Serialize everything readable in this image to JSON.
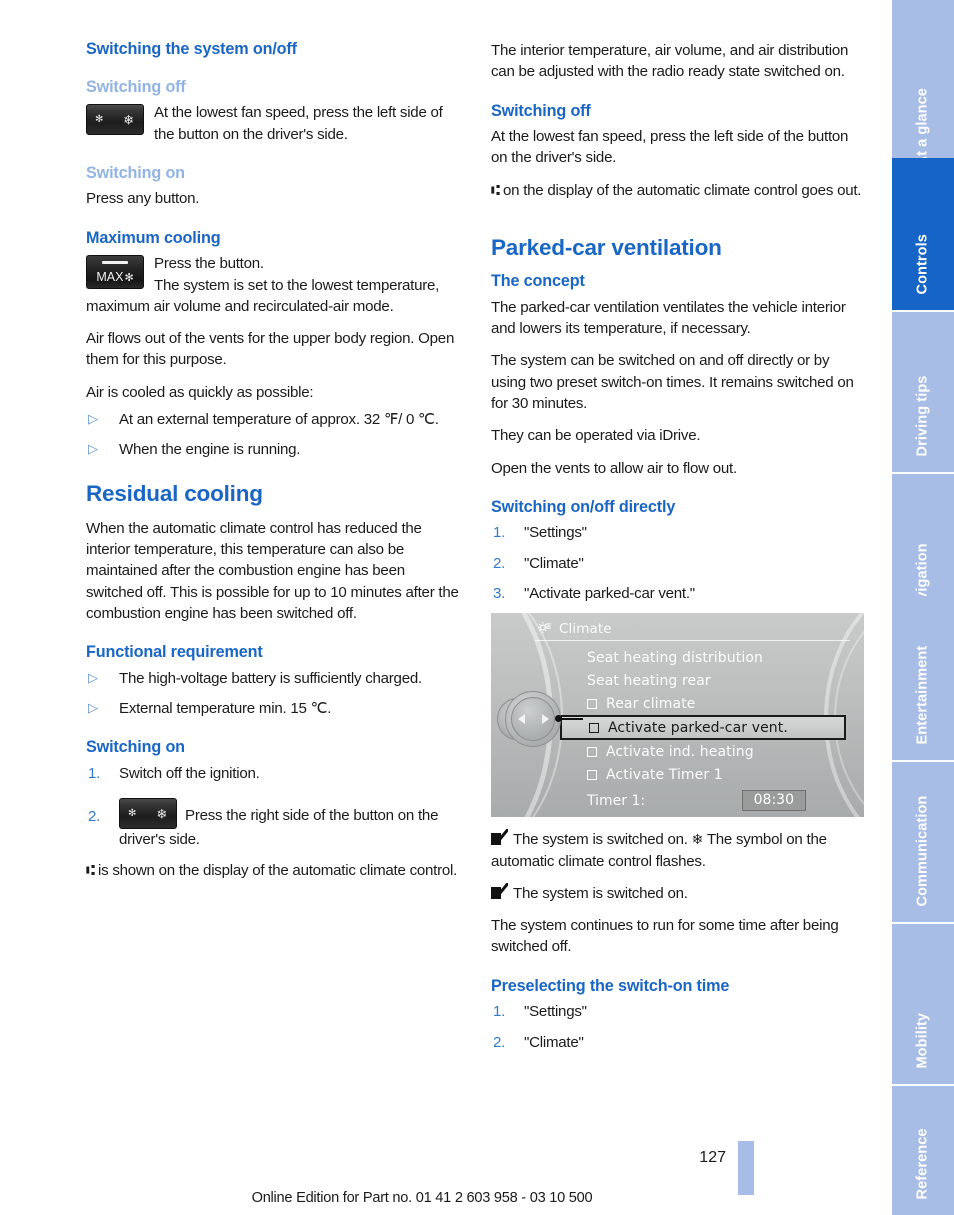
{
  "colors": {
    "heading_blue": "#1a66c4",
    "subhead_light_blue": "#92b4e2",
    "tab_inactive": "#a7bde5",
    "tab_active": "#1664c6",
    "bullet_blue": "#5b93d6"
  },
  "left_column": {
    "h_switching_system": "Switching the system on/off",
    "sub_switching_off": "Switching off",
    "fan_button_off_text": "At the lowest fan speed, press the left side of the button on the driver's side.",
    "sub_switching_on": "Switching on",
    "switching_on_text": "Press any button.",
    "h_maximum_cooling": "Maximum cooling",
    "max_press": "Press the button.",
    "max_result": "The system is set to the lowest temperature, maximum air volume and recirculated-air mode.",
    "max_p1": "Air flows out of the vents for the upper body region. Open them for this purpose.",
    "max_p2": "Air is cooled as quickly as possible:",
    "max_bullets": [
      "At an external temperature of approx. 32 ℉/ 0 ℃.",
      "When the engine is running."
    ],
    "h_residual_cooling": "Residual cooling",
    "residual_p1": "When the automatic climate control has reduced the interior temperature, this temperature can also be maintained after the combustion engine has been switched off. This is possible for up to 10 minutes after the combustion engine has been switched off.",
    "h_functional_requirement": "Functional requirement",
    "functional_bullets": [
      "The high-voltage battery is sufficiently charged.",
      "External temperature min. 15 ℃."
    ],
    "h_switching_on2": "Switching on",
    "steps": [
      {
        "n": "1.",
        "text": "Switch off the ignition."
      },
      {
        "n": "2.",
        "text": "Press the right side of the button on the driver's side."
      }
    ],
    "final_note": "is shown on the display of the automatic climate control.",
    "airflow_glyph": "⑆"
  },
  "right_column": {
    "intro": "The interior temperature, air volume, and air distribution can be adjusted with the radio ready state switched on.",
    "h_switching_off": "Switching off",
    "switching_off_p1": "At the lowest fan speed, press the left side of the button on the driver's side.",
    "switching_off_p2": "on the display of the automatic climate control goes out.",
    "h_parked_car_ventilation": "Parked-car ventilation",
    "h_the_concept": "The concept",
    "concept_p1": "The parked-car ventilation ventilates the vehicle interior and lowers its temperature, if necessary.",
    "concept_p2": "The system can be switched on and off directly or by using two preset switch-on times. It remains switched on for 30 minutes.",
    "concept_p3": "They can be operated via iDrive.",
    "concept_p4": "Open the vents to allow air to flow out.",
    "h_switching_directly": "Switching on/off directly",
    "direct_steps": [
      {
        "n": "1.",
        "text": "\"Settings\""
      },
      {
        "n": "2.",
        "text": "\"Climate\""
      },
      {
        "n": "3.",
        "text": "\"Activate parked-car vent.\""
      }
    ],
    "result1_a": "The system is switched on.",
    "result1_b": "The symbol on the automatic climate control flashes.",
    "result2": "The system is switched on.",
    "after_note": "The system continues to run for some time after being switched off.",
    "h_preselecting": "Preselecting the switch-on time",
    "preselect_steps": [
      {
        "n": "1.",
        "text": "\"Settings\""
      },
      {
        "n": "2.",
        "text": "\"Climate\""
      }
    ]
  },
  "idrive": {
    "title": "Climate",
    "items": [
      {
        "label": "Seat heating distribution",
        "checkbox": false,
        "selected": false
      },
      {
        "label": "Seat heating rear",
        "checkbox": false,
        "selected": false
      },
      {
        "label": "Rear climate",
        "checkbox": true,
        "selected": false
      },
      {
        "label": "Activate parked-car vent.",
        "checkbox": true,
        "selected": true
      },
      {
        "label": "Activate ind. heating",
        "checkbox": true,
        "selected": false
      },
      {
        "label": "Activate Timer 1",
        "checkbox": true,
        "selected": false
      }
    ],
    "timer_label": "Timer 1:",
    "timer_value": "08:30"
  },
  "buttons": {
    "fan_left_glyph": "✻",
    "fan_right_glyph": "❄",
    "max_label": "MAX",
    "max_snow": "✻"
  },
  "sidebar": {
    "tabs": [
      {
        "label": "At a glance",
        "active": false
      },
      {
        "label": "Controls",
        "active": true
      },
      {
        "label": "Driving tips",
        "active": false
      },
      {
        "label": "Navigation",
        "active": false
      },
      {
        "label": "Entertainment",
        "active": false
      },
      {
        "label": "Communication",
        "active": false
      },
      {
        "label": "Mobility",
        "active": false
      },
      {
        "label": "Reference",
        "active": false
      }
    ]
  },
  "footer": {
    "page_number": "127",
    "edition": "Online Edition for Part no. 01 41 2 603 958 - 03 10 500"
  }
}
